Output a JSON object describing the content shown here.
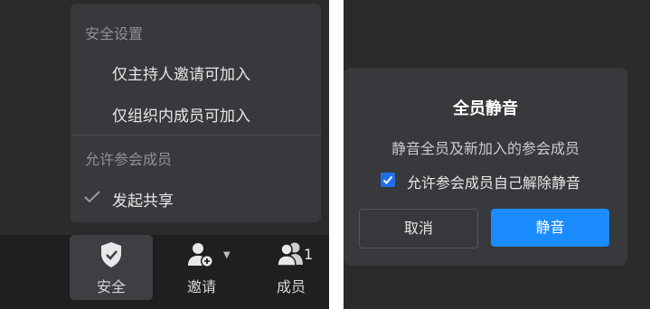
{
  "security_menu": {
    "section_security": "安全设置",
    "items": [
      "仅主持人邀请可加入",
      "仅组织内成员可加入"
    ],
    "section_participants": "允许参会成员",
    "participant_items": [
      {
        "label": "发起共享",
        "checked": true
      }
    ]
  },
  "toolbar": {
    "security": {
      "label": "安全",
      "icon": "shield-check-icon",
      "active": true
    },
    "invite": {
      "label": "邀请",
      "icon": "add-user-icon"
    },
    "members": {
      "label": "成员",
      "icon": "members-icon",
      "count": "1"
    }
  },
  "dialog": {
    "title": "全员静音",
    "message": "静音全员及新加入的参会成员",
    "checkbox_label": "允许参会成员自己解除静音",
    "checkbox_checked": true,
    "cancel_label": "取消",
    "confirm_label": "静音"
  },
  "colors": {
    "background": "#2b2b2d",
    "panel": "#38393c",
    "primary": "#1b8cff",
    "text": "#e6e6e8",
    "muted": "#8f9095"
  }
}
